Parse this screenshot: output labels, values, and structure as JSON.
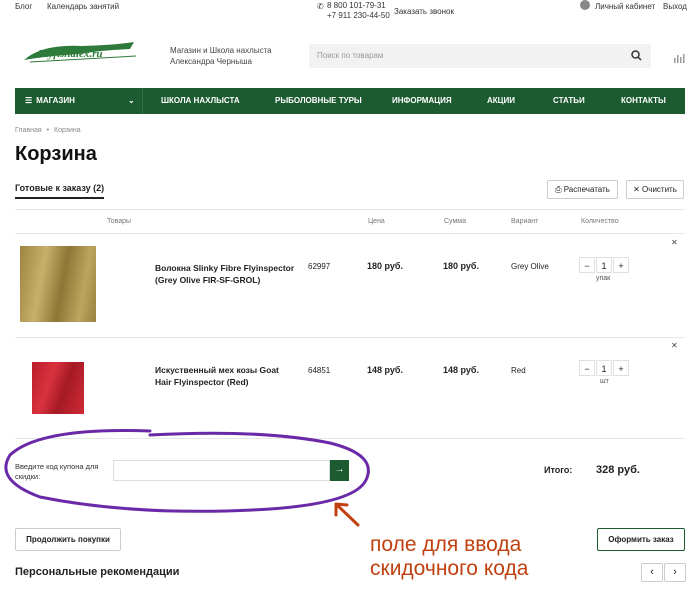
{
  "topbar": {
    "blog": "Блог",
    "calendar": "Календарь занятий",
    "phone1": "8 800 101-79-31",
    "phone2": "+7 911 230-44-50",
    "callback": "Заказать звонок",
    "account": "Личный кабинет",
    "logout": "Выход"
  },
  "header": {
    "logo_text": "Flyfishalex.ru",
    "tagline": "Магазин и Школа нахлыста Александра Черныша",
    "search_placeholder": "Поиск по товарам"
  },
  "nav": {
    "shop": "МАГАЗИН",
    "items": [
      "ШКОЛА НАХЛЫСТА",
      "РЫБОЛОВНЫЕ ТУРЫ",
      "ИНФОРМАЦИЯ",
      "АКЦИИ",
      "СТАТЬИ",
      "КОНТАКТЫ"
    ]
  },
  "breadcrumb": {
    "home": "Главная",
    "sep": "•",
    "current": "Корзина"
  },
  "page_title": "Корзина",
  "tab": "Готовые к заказу (2)",
  "actions": {
    "print": "Распечатать",
    "clear": "Очистить"
  },
  "table": {
    "headers": {
      "goods": "Товары",
      "price": "Цена",
      "sum": "Сумма",
      "variant": "Вариант",
      "qty": "Количество"
    },
    "rows": [
      {
        "name": "Волокна Slinky Fibre Flyinspector (Grey Olive FIR-SF-GROL)",
        "code": "62997",
        "price": "180 руб.",
        "sum": "180 руб.",
        "variant": "Grey Olive",
        "qty": "1",
        "unit": "упак",
        "color": "#a08a45"
      },
      {
        "name": "Искуственный мех козы Goat Hair Flyinspector (Red)",
        "code": "64851",
        "price": "148 руб.",
        "sum": "148 руб.",
        "variant": "Red",
        "qty": "1",
        "unit": "шт",
        "color": "#c8242e"
      }
    ]
  },
  "coupon": {
    "label": "Введите код купона для скидки:",
    "button": "→"
  },
  "total": {
    "label": "Итого:",
    "value": "328 руб."
  },
  "buttons": {
    "continue": "Продолжить покупки",
    "order": "Оформить заказ"
  },
  "recommend": "Персональные рекомендации",
  "annotation": "поле для ввода скидочного кода",
  "colors": {
    "brand_green": "#1c5a30",
    "annotation_purple": "#6a2aa8",
    "annotation_orange": "#c0410f"
  }
}
